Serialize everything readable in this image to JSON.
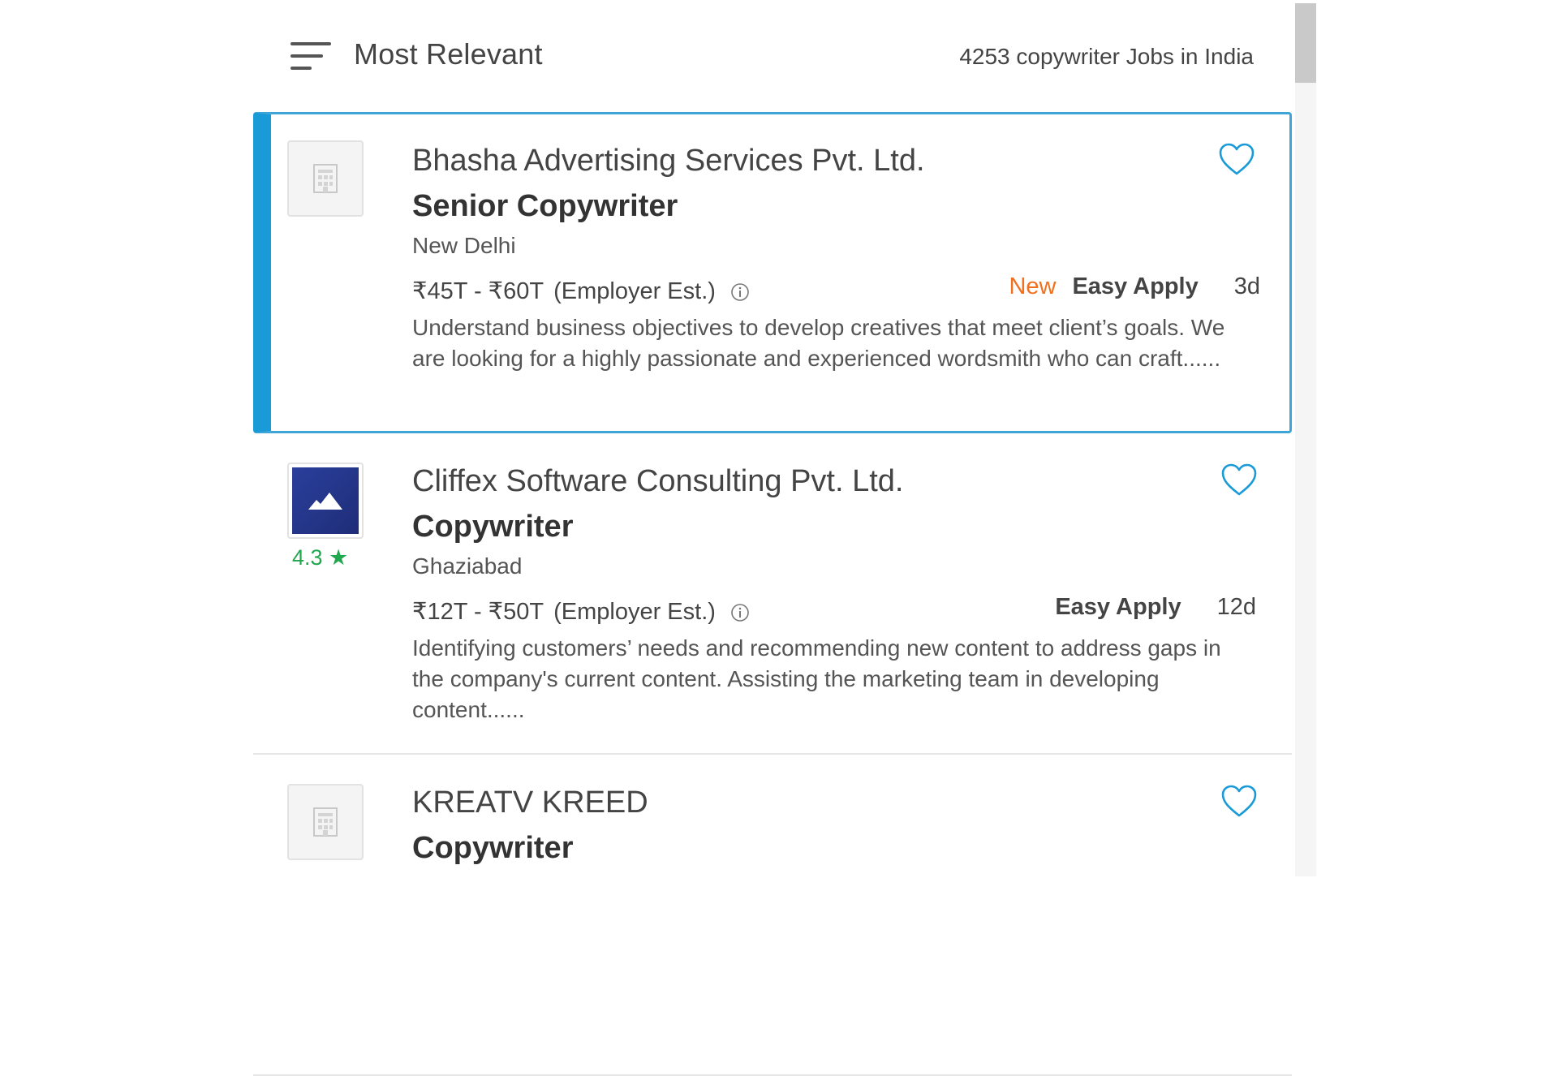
{
  "header": {
    "sort_label": "Most Relevant",
    "job_count": "4253 copywriter Jobs in India"
  },
  "jobs": [
    {
      "company": "Bhasha Advertising Services Pvt. Ltd.",
      "title": "Senior Copywriter",
      "location": "New Delhi",
      "salary": "₹45T - ₹60T",
      "salary_note": "(Employer Est.)",
      "tag_new": "New",
      "easy_apply": "Easy Apply",
      "age": "3d",
      "description": "Understand business objectives to develop creatives that meet client’s goals. We are looking for a highly passionate and experienced wordsmith who can craft......",
      "selected": true,
      "logo": "building-placeholder-icon"
    },
    {
      "company": "Cliffex Software Consulting Pvt. Ltd.",
      "title": "Copywriter",
      "location": "Ghaziabad",
      "rating": "4.3 ★",
      "salary": "₹12T - ₹50T",
      "salary_note": "(Employer Est.)",
      "easy_apply": "Easy Apply",
      "age": "12d",
      "description": "Identifying customers’ needs and recommending new content to address gaps in the company's current content. Assisting the marketing team in developing content......",
      "selected": false,
      "logo": "mountain-logo-icon"
    },
    {
      "company": "KREATV KREED",
      "title": "Copywriter",
      "selected": false,
      "logo": "building-placeholder-icon"
    }
  ],
  "colors": {
    "accent": "#1a9bd7",
    "new_tag": "#f0701e",
    "rating": "#21a84f",
    "heart": "#1a9bd7"
  }
}
